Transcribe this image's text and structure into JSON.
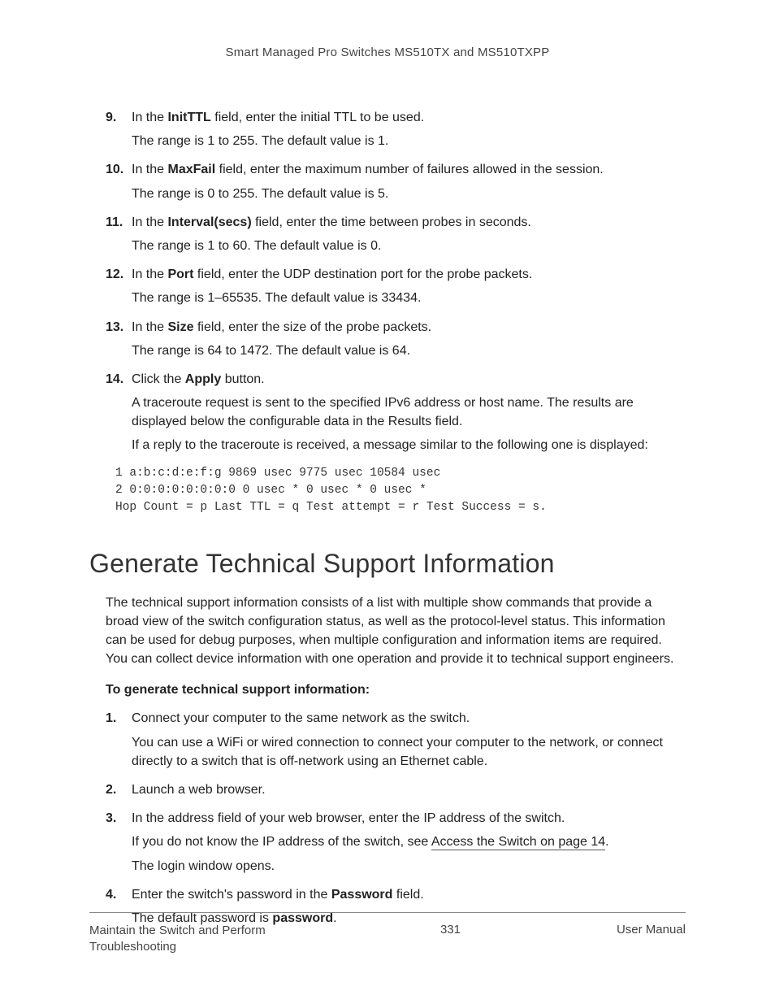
{
  "header": {
    "title": "Smart Managed Pro Switches MS510TX and MS510TXPP"
  },
  "steps_a": [
    {
      "n": "9.",
      "parts": [
        {
          "segs": [
            {
              "t": "In the "
            },
            {
              "t": "InitTTL",
              "b": true
            },
            {
              "t": " field, enter the initial TTL to be used."
            }
          ]
        },
        {
          "segs": [
            {
              "t": "The range is 1 to 255. The default value is 1."
            }
          ]
        }
      ]
    },
    {
      "n": "10.",
      "parts": [
        {
          "segs": [
            {
              "t": "In the "
            },
            {
              "t": "MaxFail",
              "b": true
            },
            {
              "t": " field, enter the maximum number of failures allowed in the session."
            }
          ]
        },
        {
          "segs": [
            {
              "t": "The range is 0 to 255. The default value is 5."
            }
          ]
        }
      ]
    },
    {
      "n": "11.",
      "parts": [
        {
          "segs": [
            {
              "t": "In the "
            },
            {
              "t": "Interval(secs)",
              "b": true
            },
            {
              "t": " field, enter the time between probes in seconds."
            }
          ]
        },
        {
          "segs": [
            {
              "t": "The range is 1 to 60. The default value is 0."
            }
          ]
        }
      ]
    },
    {
      "n": "12.",
      "parts": [
        {
          "segs": [
            {
              "t": "In the "
            },
            {
              "t": "Port",
              "b": true
            },
            {
              "t": " field, enter the UDP destination port for the probe packets."
            }
          ]
        },
        {
          "segs": [
            {
              "t": "The range is 1–65535. The default value is 33434."
            }
          ]
        }
      ]
    },
    {
      "n": "13.",
      "parts": [
        {
          "segs": [
            {
              "t": "In the "
            },
            {
              "t": "Size",
              "b": true
            },
            {
              "t": " field, enter the size of the probe packets."
            }
          ]
        },
        {
          "segs": [
            {
              "t": "The range is 64 to 1472. The default value is 64."
            }
          ]
        }
      ]
    },
    {
      "n": "14.",
      "parts": [
        {
          "segs": [
            {
              "t": "Click the "
            },
            {
              "t": "Apply",
              "b": true
            },
            {
              "t": " button."
            }
          ]
        },
        {
          "segs": [
            {
              "t": "A traceroute request is sent to the specified IPv6 address or host name. The results are displayed below the configurable data in the Results field."
            }
          ]
        },
        {
          "segs": [
            {
              "t": "If a reply to the traceroute is received, a message similar to the following one is displayed:"
            }
          ]
        }
      ]
    }
  ],
  "code_block": "1 a:b:c:d:e:f:g 9869 usec 9775 usec 10584 usec\n2 0:0:0:0:0:0:0:0 0 usec * 0 usec * 0 usec *\nHop Count = p Last TTL = q Test attempt = r Test Success = s.",
  "section": {
    "title": "Generate Technical Support Information",
    "intro": "The technical support information consists of a list with multiple show commands that provide a broad view of the switch configuration status, as well as the protocol-level status. This information can be used for debug purposes, when multiple configuration and information items are required. You can collect device information with one operation and provide it to technical support engineers.",
    "subhead": "To generate technical support information:"
  },
  "steps_b": [
    {
      "n": "1.",
      "parts": [
        {
          "segs": [
            {
              "t": "Connect your computer to the same network as the switch."
            }
          ]
        },
        {
          "segs": [
            {
              "t": "You can use a WiFi or wired connection to connect your computer to the network, or connect directly to a switch that is off-network using an Ethernet cable."
            }
          ]
        }
      ]
    },
    {
      "n": "2.",
      "parts": [
        {
          "segs": [
            {
              "t": "Launch a web browser."
            }
          ]
        }
      ]
    },
    {
      "n": "3.",
      "parts": [
        {
          "segs": [
            {
              "t": "In the address field of your web browser, enter the IP address of the switch."
            }
          ]
        },
        {
          "segs": [
            {
              "t": "If you do not know the IP address of the switch, see "
            },
            {
              "t": "Access the Switch on page 14",
              "link": true
            },
            {
              "t": "."
            }
          ]
        },
        {
          "segs": [
            {
              "t": "The login window opens."
            }
          ]
        }
      ]
    },
    {
      "n": "4.",
      "parts": [
        {
          "segs": [
            {
              "t": "Enter the switch's password in the "
            },
            {
              "t": "Password",
              "b": true
            },
            {
              "t": " field."
            }
          ]
        },
        {
          "segs": [
            {
              "t": "The default password is "
            },
            {
              "t": "password",
              "b": true
            },
            {
              "t": "."
            }
          ]
        }
      ]
    }
  ],
  "footer": {
    "left": "Maintain the Switch and Perform Troubleshooting",
    "center": "331",
    "right": "User Manual"
  }
}
